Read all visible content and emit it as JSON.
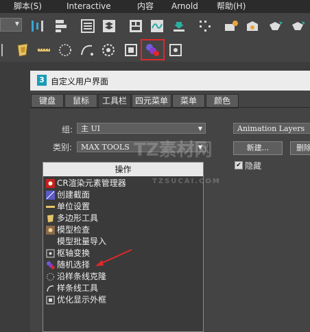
{
  "menubar": {
    "items": [
      "脚本(S)",
      "Interactive",
      "内容",
      "Arnold",
      "帮助(H)"
    ]
  },
  "toolbar1": {
    "icons": [
      "align-icon",
      "distribute-icon",
      "list-icon",
      "layers-icon",
      "schematic-icon",
      "curve-editor-icon",
      "import-icon",
      "scatter-icon",
      "render-setup-icon",
      "render-frame-icon",
      "render-icon",
      "render-cloud-icon"
    ]
  },
  "toolbar2": {
    "icons": [
      "polygon-tools-icon",
      "unit-setup-icon",
      "clone-along-spline-icon",
      "spline-tools-icon",
      "pivot-transform-icon",
      "display-bbox-icon",
      "random-select-icon",
      "pivot-icon"
    ],
    "highlighted": "random-select-icon",
    "highlight_color": "#e0282a"
  },
  "dialog": {
    "title": "自定义用户界面",
    "logo": "3",
    "tabs": [
      "键盘",
      "鼠标",
      "工具栏",
      "四元菜单",
      "菜单",
      "颜色"
    ],
    "active_tab": "工具栏",
    "group_label": "组:",
    "group_value": "主 UI",
    "category_label": "类别:",
    "category_value": "MAX TOOLS",
    "right_select_value": "Animation Layers",
    "new_button": "新建...",
    "delete_button": "删除",
    "hide_label": "隐藏",
    "hide_checked": true,
    "actions_header": "操作",
    "actions": [
      {
        "label": "CR渲染元素管理器",
        "icon": "cr-render-icon"
      },
      {
        "label": "创建截面",
        "icon": "section-icon"
      },
      {
        "label": "单位设置",
        "icon": "unit-setup-icon"
      },
      {
        "label": "多边形工具",
        "icon": "polygon-tools-icon"
      },
      {
        "label": "模型检查",
        "icon": "model-check-icon"
      },
      {
        "label": "模型批量导入",
        "icon": ""
      },
      {
        "label": "枢轴变换",
        "icon": "pivot-transform-icon"
      },
      {
        "label": "随机选择",
        "icon": "random-select-icon"
      },
      {
        "label": "沿样条线克隆",
        "icon": "clone-along-spline-icon"
      },
      {
        "label": "样条线工具",
        "icon": "spline-tools-icon"
      },
      {
        "label": "优化显示外框",
        "icon": "display-bbox-icon"
      }
    ]
  },
  "watermark": {
    "line1": "TZ素材网",
    "line2": "TZSUCAI.COM"
  },
  "annotation": {
    "arrow_color": "#e0282a"
  }
}
